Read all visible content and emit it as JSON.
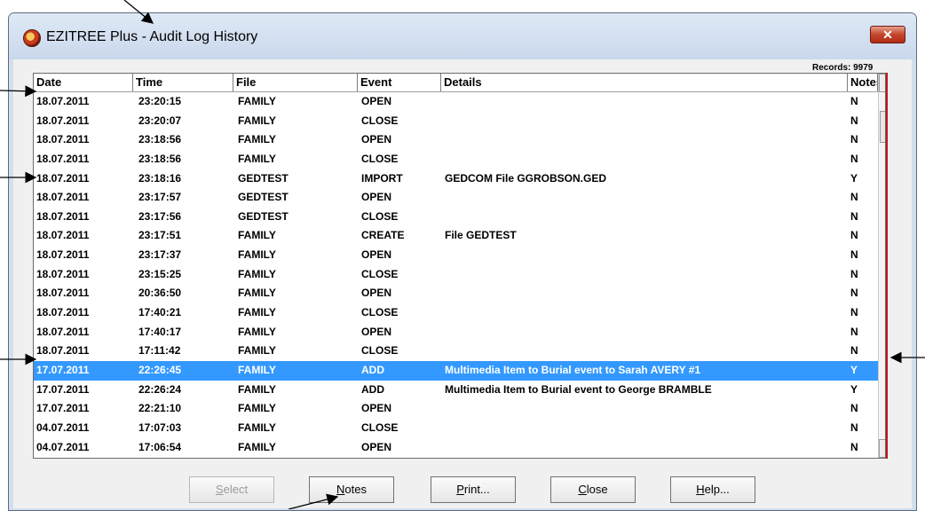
{
  "window": {
    "title": "EZITREE Plus - Audit Log History",
    "close_glyph": "✕"
  },
  "records_label": "Records: 9979",
  "columns": [
    "Date",
    "Time",
    "File",
    "Event",
    "Details",
    "Notes"
  ],
  "rows": [
    {
      "date": "18.07.2011",
      "time": "23:20:15",
      "file": "FAMILY",
      "event": "OPEN",
      "details": "",
      "notes": "N"
    },
    {
      "date": "18.07.2011",
      "time": "23:20:07",
      "file": "FAMILY",
      "event": "CLOSE",
      "details": "",
      "notes": "N"
    },
    {
      "date": "18.07.2011",
      "time": "23:18:56",
      "file": "FAMILY",
      "event": "OPEN",
      "details": "",
      "notes": "N"
    },
    {
      "date": "18.07.2011",
      "time": "23:18:56",
      "file": "FAMILY",
      "event": "CLOSE",
      "details": "",
      "notes": "N"
    },
    {
      "date": "18.07.2011",
      "time": "23:18:16",
      "file": "GEDTEST",
      "event": "IMPORT",
      "details": "GEDCOM File GGROBSON.GED",
      "notes": "Y"
    },
    {
      "date": "18.07.2011",
      "time": "23:17:57",
      "file": "GEDTEST",
      "event": "OPEN",
      "details": "",
      "notes": "N"
    },
    {
      "date": "18.07.2011",
      "time": "23:17:56",
      "file": "GEDTEST",
      "event": "CLOSE",
      "details": "",
      "notes": "N"
    },
    {
      "date": "18.07.2011",
      "time": "23:17:51",
      "file": "FAMILY",
      "event": "CREATE",
      "details": "File GEDTEST",
      "notes": "N"
    },
    {
      "date": "18.07.2011",
      "time": "23:17:37",
      "file": "FAMILY",
      "event": "OPEN",
      "details": "",
      "notes": "N"
    },
    {
      "date": "18.07.2011",
      "time": "23:15:25",
      "file": "FAMILY",
      "event": "CLOSE",
      "details": "",
      "notes": "N"
    },
    {
      "date": "18.07.2011",
      "time": "20:36:50",
      "file": "FAMILY",
      "event": "OPEN",
      "details": "",
      "notes": "N"
    },
    {
      "date": "18.07.2011",
      "time": "17:40:21",
      "file": "FAMILY",
      "event": "CLOSE",
      "details": "",
      "notes": "N"
    },
    {
      "date": "18.07.2011",
      "time": "17:40:17",
      "file": "FAMILY",
      "event": "OPEN",
      "details": "",
      "notes": "N"
    },
    {
      "date": "18.07.2011",
      "time": "17:11:42",
      "file": "FAMILY",
      "event": "CLOSE",
      "details": "",
      "notes": "N"
    },
    {
      "date": "17.07.2011",
      "time": "22:26:45",
      "file": "FAMILY",
      "event": "ADD",
      "details": "Multimedia Item to Burial event to Sarah AVERY #1",
      "notes": "Y",
      "selected": true
    },
    {
      "date": "17.07.2011",
      "time": "22:26:24",
      "file": "FAMILY",
      "event": "ADD",
      "details": "Multimedia Item to Burial event to George BRAMBLE",
      "notes": "Y"
    },
    {
      "date": "17.07.2011",
      "time": "22:21:10",
      "file": "FAMILY",
      "event": "OPEN",
      "details": "",
      "notes": "N"
    },
    {
      "date": "04.07.2011",
      "time": "17:07:03",
      "file": "FAMILY",
      "event": "CLOSE",
      "details": "",
      "notes": "N"
    },
    {
      "date": "04.07.2011",
      "time": "17:06:54",
      "file": "FAMILY",
      "event": "OPEN",
      "details": "",
      "notes": "N"
    }
  ],
  "scrollbar": {
    "up_glyph": "▲",
    "down_glyph": "▼"
  },
  "buttons": [
    {
      "name": "select-button",
      "accel": "S",
      "rest": "elect",
      "disabled": true
    },
    {
      "name": "notes-button",
      "accel": "N",
      "rest": "otes",
      "disabled": false
    },
    {
      "name": "print-button",
      "accel": "P",
      "rest": "rint...",
      "disabled": false
    },
    {
      "name": "close-button",
      "accel": "C",
      "rest": "lose",
      "disabled": false
    },
    {
      "name": "help-button",
      "accel": "H",
      "rest": "elp...",
      "disabled": false
    }
  ],
  "colors": {
    "selection": "#3399ff",
    "accent_line": "#c0141a"
  }
}
